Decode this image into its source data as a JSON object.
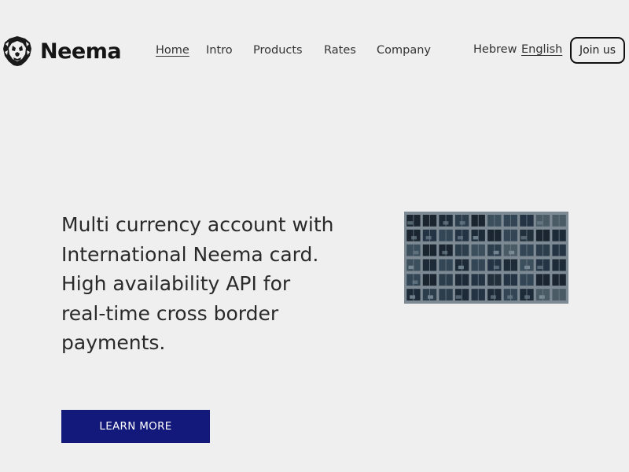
{
  "brand": {
    "name": "Neema",
    "logo_icon": "lion-head-icon"
  },
  "nav": {
    "items": [
      {
        "label": "Home",
        "active": true
      },
      {
        "label": "Intro",
        "active": false
      },
      {
        "label": "Products",
        "active": false
      },
      {
        "label": "Rates",
        "active": false
      },
      {
        "label": "Company",
        "active": false
      }
    ]
  },
  "languages": [
    {
      "label": "Hebrew",
      "active": false
    },
    {
      "label": "English",
      "active": true
    }
  ],
  "join_label": "Join us",
  "hero": {
    "lines": [
      "Multi currency account with",
      "International Neema card.",
      "High availability API for",
      "real-time cross border",
      "payments."
    ],
    "cta_label": "LEARN MORE",
    "image": "office-building-facade-photo"
  },
  "colors": {
    "background": "#efefef",
    "cta_background": "#12197a",
    "cta_text": "#ffffff",
    "text": "#2a2a2a"
  }
}
